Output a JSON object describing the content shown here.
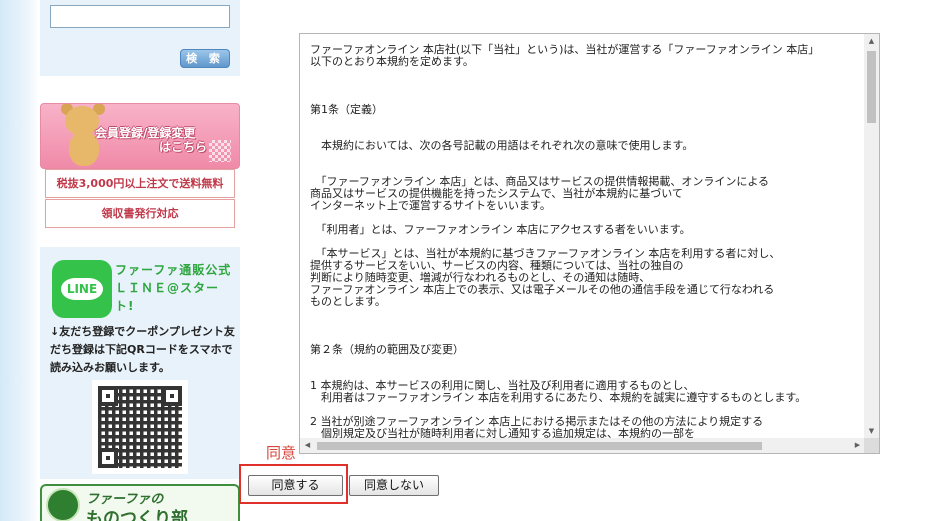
{
  "sidebar": {
    "search": {
      "input_value": "",
      "button_label": "検 索"
    },
    "member_banner": {
      "line1": "会員登録/登録変更",
      "line2": "はこちら"
    },
    "notices": {
      "free_shipping": "税抜3,000円以上注文で送料無料",
      "receipt": "領収書発行対応"
    },
    "line": {
      "logo_text": "LINE",
      "title": "ファーファ通販公式ＬＩＮＥ@スタート!",
      "description": "↓友だち登録でクーポンプレゼント友だち登録は下記QRコードをスマホで読み込みお願いします。"
    },
    "mono_banner": {
      "line1": "ファーファの",
      "line2": "ものつくり部"
    }
  },
  "terms": {
    "text": "ファーファオンライン 本店社(以下「当社」という)は、当社が運営する「ファーファオンライン 本店」\n以下のとおり本規約を定めます。\n\n\n\n第1条（定義）\n\n\n　本規約においては、次の各号記載の用語はそれぞれ次の意味で使用します。\n\n\n　「ファーファオンライン 本店」とは、商品又はサービスの提供情報掲載、オンラインによる\n商品又はサービスの提供機能を持ったシステムで、当社が本規約に基づいて\nインターネット上で運営するサイトをいいます。\n\n　「利用者」とは、ファーファオンライン 本店にアクセスする者をいいます。\n\n　「本サービス」とは、当社が本規約に基づきファーファオンライン 本店を利用する者に対し、\n提供するサービスをいい、サービスの内容、種類については、当社の独自の\n判断により随時変更、増減が行なわれるものとし、その通知は随時、\nファーファオンライン 本店上での表示、又は電子メールその他の通信手段を通じて行なわれる\nものとします。\n\n\n\n第２条（規約の範囲及び変更）\n\n\n1 本規約は、本サービスの利用に関し、当社及び利用者に適用するものとし、\n　利用者はファーファオンライン 本店を利用するにあたり、本規約を誠実に遵守するものとします。\n\n2 当社が別途ファーファオンライン 本店上における掲示またはその他の方法により規定する\n　個別規定及び当社が随時利用者に対し通知する追加規定は、本規約の一部を\n　構成します。"
  },
  "agreement": {
    "label": "同意",
    "agree_button": "同意する",
    "disagree_button": "同意しない"
  },
  "colors": {
    "accent_red": "#e0302c",
    "line_green": "#35c24a",
    "sidebar_bg": "#e8f2fa"
  }
}
